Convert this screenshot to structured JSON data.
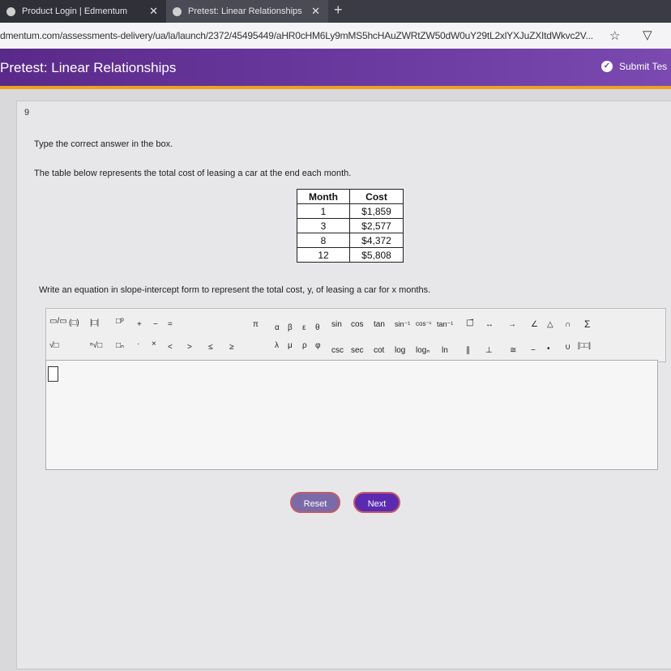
{
  "browser": {
    "tabs": [
      {
        "label": "Product Login | Edmentum",
        "close": "✕"
      },
      {
        "label": "Pretest: Linear Relationships",
        "close": "✕"
      }
    ],
    "new_tab": "+",
    "url": "dmentum.com/assessments-delivery/ua/la/launch/2372/45495449/aHR0cHM6Ly9mMS5hcHAuZWRtZW50dW0uY29tL2xlYXJuZXItdWkvc2V..."
  },
  "header": {
    "title": "Pretest: Linear Relationships",
    "submit_label": "Submit Tes"
  },
  "question": {
    "number": "9",
    "instruction": "Type the correct answer in the box.",
    "prompt": "The table below represents the total cost of leasing a car at the end each month.",
    "table": {
      "headers": [
        "Month",
        "Cost"
      ],
      "rows": [
        [
          "1",
          "$1,859"
        ],
        [
          "3",
          "$2,577"
        ],
        [
          "8",
          "$4,372"
        ],
        [
          "12",
          "$5,808"
        ]
      ]
    },
    "task": "Write an equation in slope-intercept form to represent the total cost, y, of leasing a car for x months."
  },
  "toolbar": {
    "fraction": "▭/▭",
    "parens": "(□)",
    "abs": "|□|",
    "power": "□ᵖ",
    "plus": "+",
    "minus": "−",
    "equals": "=",
    "sqrt": "√□",
    "nthroot": "ⁿ√□",
    "subscript": "□ₙ",
    "dot": "·",
    "times": "×",
    "lt": "<",
    "gt": ">",
    "le": "≤",
    "ge": "≥",
    "pi": "π",
    "alpha": "α",
    "beta": "β",
    "epsilon": "ε",
    "theta": "θ",
    "Lambda": "λ",
    "mu": "μ",
    "rho": "ρ",
    "phi": "φ",
    "sin": "sin",
    "cos": "cos",
    "tan": "tan",
    "arcsin": "sin⁻¹",
    "arccos": "cos⁻¹",
    "arctan": "tan⁻¹",
    "csc": "csc",
    "sec": "sec",
    "cot": "cot",
    "log": "log",
    "logn": "logₙ",
    "ln": "ln",
    "vector": "□⃗",
    "line": "↔",
    "ray": "→",
    "angle": "∠",
    "triangle": "△",
    "intersect": "∩",
    "sum": "Σ",
    "parallel": "∥",
    "perp": "⊥",
    "approx": "≅",
    "similar": "~",
    "bullet": "•",
    "union": "∪",
    "matrix": "[□□]"
  },
  "buttons": {
    "reset": "Reset",
    "next": "Next"
  }
}
